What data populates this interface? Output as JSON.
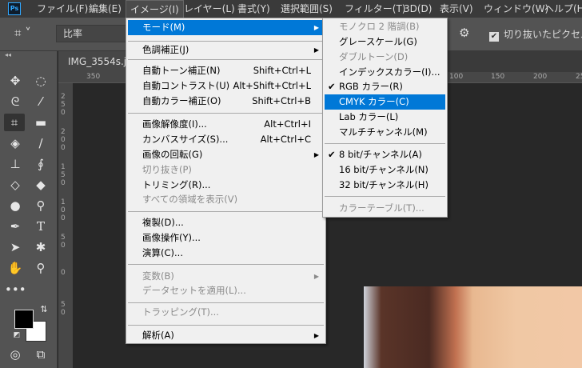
{
  "menubar": {
    "logo": "Ps",
    "items": [
      "ファイル(F)",
      "編集(E)",
      "イメージ(I)",
      "レイヤー(L)",
      "書式(Y)",
      "選択範囲(S)",
      "フィルター(T)",
      "3D(D)",
      "表示(V)",
      "ウィンドウ(W)",
      "ヘルプ(H)"
    ],
    "active": "イメージ(I)"
  },
  "options_bar": {
    "ratio": "比率",
    "delete_cropped": "切り抜いたピクセルを",
    "delete_cropped_checked": true
  },
  "document_tab": "IMG_3554s.jpg",
  "ruler": {
    "h_ticks": [
      "350",
      "100",
      "150",
      "200",
      "250"
    ],
    "v_ticks": [
      "250",
      "200",
      "150",
      "100",
      "50",
      "0",
      "50"
    ]
  },
  "colors": {
    "highlight": "#0078d7",
    "foreground": "#000000",
    "background": "#ffffff"
  },
  "image_menu": {
    "mode": "モード(M)",
    "adjust": "色調補正(J)",
    "auto_tone": "自動トーン補正(N)",
    "auto_tone_sc": "Shift+Ctrl+L",
    "auto_contrast": "自動コントラスト(U)",
    "auto_contrast_sc": "Alt+Shift+Ctrl+L",
    "auto_color": "自動カラー補正(O)",
    "auto_color_sc": "Shift+Ctrl+B",
    "image_size": "画像解像度(I)...",
    "image_size_sc": "Alt+Ctrl+I",
    "canvas_size": "カンバスサイズ(S)...",
    "canvas_size_sc": "Alt+Ctrl+C",
    "rotate": "画像の回転(G)",
    "crop": "切り抜き(P)",
    "trim": "トリミング(R)...",
    "reveal_all": "すべての領域を表示(V)",
    "duplicate": "複製(D)...",
    "apply_image": "画像操作(Y)...",
    "calculations": "演算(C)...",
    "variables": "変数(B)",
    "apply_dataset": "データセットを適用(L)...",
    "trapping": "トラッピング(T)...",
    "analysis": "解析(A)"
  },
  "mode_submenu": {
    "bitmap": "モノクロ 2 階調(B)",
    "grayscale": "グレースケール(G)",
    "duotone": "ダブルトーン(D)",
    "indexed": "インデックスカラー(I)...",
    "rgb": "RGB カラー(R)",
    "cmyk": "CMYK カラー(C)",
    "lab": "Lab カラー(L)",
    "multichannel": "マルチチャンネル(M)",
    "bit8": "8 bit/チャンネル(A)",
    "bit16": "16 bit/チャンネル(N)",
    "bit32": "32 bit/チャンネル(H)",
    "color_table": "カラーテーブル(T)...",
    "check": "✔"
  }
}
